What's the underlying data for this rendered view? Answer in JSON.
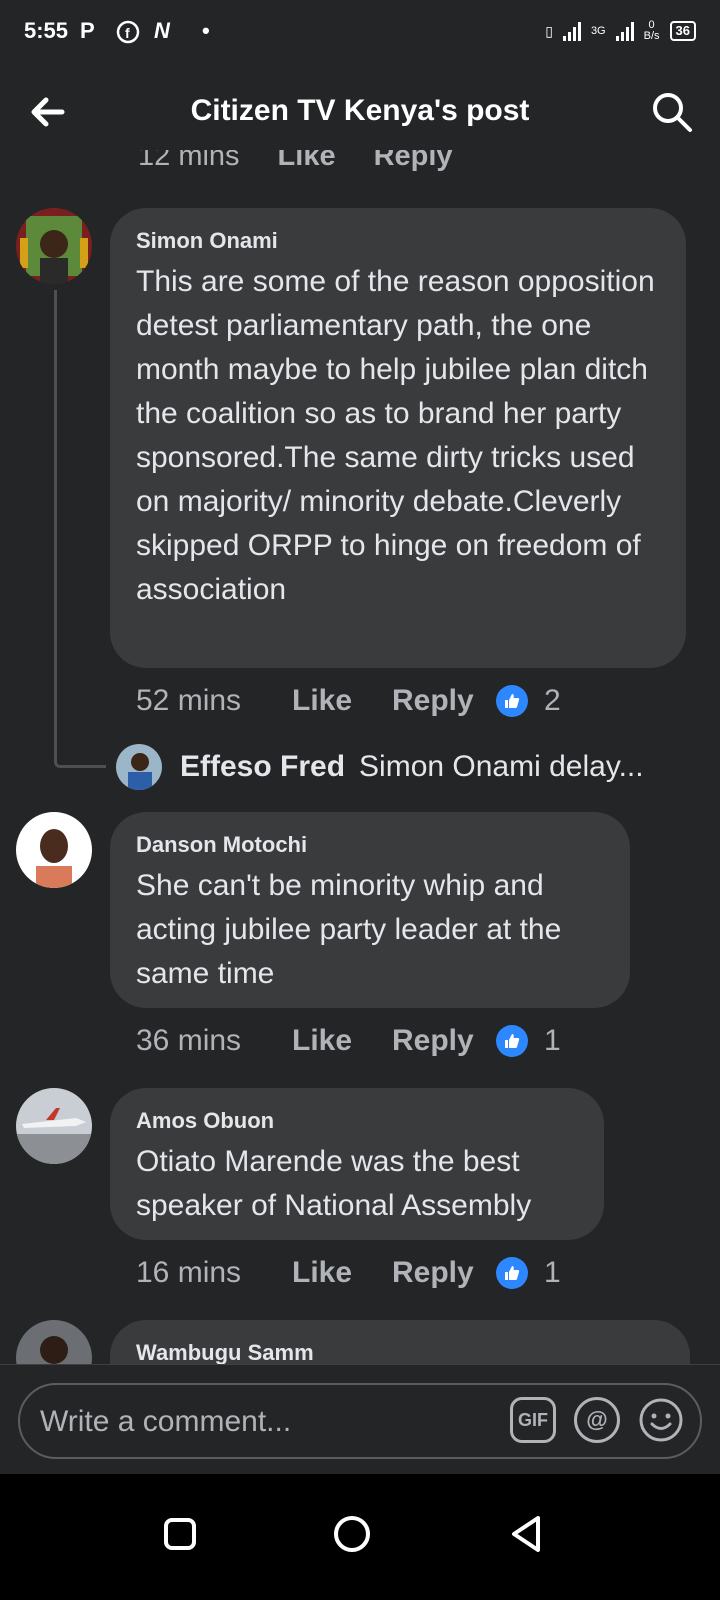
{
  "status": {
    "time": "5:55",
    "icons": [
      "p-icon",
      "facebook-icon",
      "n-icon",
      "dot-icon"
    ],
    "network": "3G",
    "speed_value": "0",
    "speed_unit": "B/s",
    "battery": "36"
  },
  "header": {
    "title": "Citizen TV Kenya's post",
    "back_icon": "arrow-left-icon",
    "search_icon": "search-icon"
  },
  "prev_comment_meta": {
    "time": "12 mins",
    "like": "Like",
    "reply": "Reply"
  },
  "comments": [
    {
      "author": "Simon Onami",
      "text": "This are some of the reason opposition detest parliamentary path, the one month maybe to help jubilee plan ditch the coalition so as to brand her party sponsored.The same dirty tricks used on majority/ minority debate.Cleverly skipped ORPP to hinge on freedom of association",
      "time": "52 mins",
      "like": "Like",
      "reply": "Reply",
      "reactions": "2"
    },
    {
      "author": "Danson Motochi",
      "text": "She can't be minority whip and acting jubilee party leader at the same time",
      "time": "36 mins",
      "like": "Like",
      "reply": "Reply",
      "reactions": "1"
    },
    {
      "author": "Amos Obuon",
      "text": "Otiato Marende was the best speaker of National Assembly",
      "time": "16 mins",
      "like": "Like",
      "reply": "Reply",
      "reactions": "1"
    },
    {
      "author": "Wambugu Samm"
    }
  ],
  "reply_preview": {
    "author": "Effeso Fred",
    "text": "Simon Onami delay..."
  },
  "composer": {
    "placeholder": "Write a comment...",
    "gif": "GIF",
    "mention": "@",
    "emoji_icon": "smiley-icon"
  },
  "navbar": {
    "icons": [
      "recent-apps-icon",
      "home-icon",
      "back-icon"
    ]
  },
  "colors": {
    "background": "#242526",
    "bubble": "#3a3b3c",
    "accent": "#2d88ff"
  }
}
